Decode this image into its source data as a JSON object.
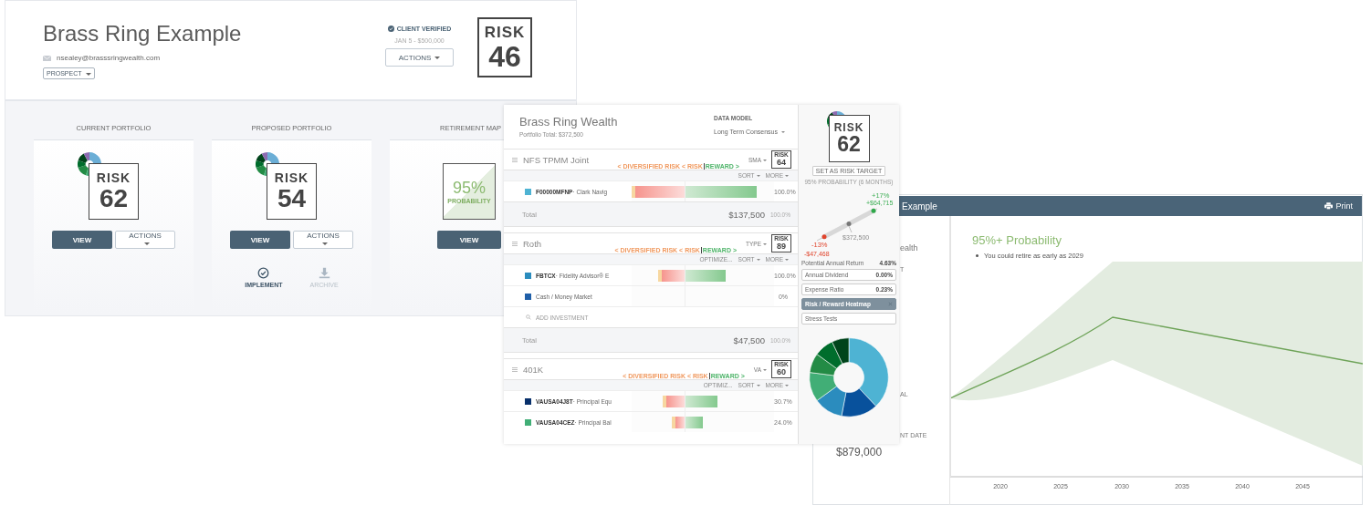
{
  "client_panel": {
    "name": "Brass Ring Example",
    "email": "nsealey@brasssringwealth.com",
    "status": "PROSPECT",
    "verification": "CLIENT VERIFIED",
    "verified_detail": "JAN 5 - $500,000",
    "actions": "ACTIONS",
    "risk": {
      "label": "RISK",
      "value": "46"
    },
    "cards": [
      {
        "kind": "portfolio",
        "title": "CURRENT PORTFOLIO",
        "risk": {
          "label": "RISK",
          "value": "62"
        },
        "view": "VIEW",
        "actions": "ACTIONS"
      },
      {
        "kind": "portfolio",
        "title": "PROPOSED PORTFOLIO",
        "risk": {
          "label": "RISK",
          "value": "54"
        },
        "view": "VIEW",
        "actions": "ACTIONS",
        "links": [
          {
            "kind": "implement",
            "label": "IMPLEMENT",
            "disabled": false
          },
          {
            "kind": "archive",
            "label": "ARCHIVE",
            "disabled": true
          }
        ]
      },
      {
        "kind": "probability",
        "title": "RETIREMENT MAP",
        "probability": {
          "value": "95%",
          "label": "PROBABILITY"
        },
        "view": "VIEW"
      }
    ]
  },
  "portfolio_panel": {
    "title": "Brass Ring Wealth",
    "total": "Portfolio Total: $372,500",
    "data_model_label": "DATA MODEL",
    "data_model": "Long Term Consensus",
    "accounts": [
      {
        "name": "NFS TPMM Joint",
        "legend_risk": "< DIVERSIFIED RISK < RISK",
        "legend_reward": "REWARD >",
        "type": "SMA",
        "risk": {
          "label": "RISK",
          "value": "64"
        },
        "tools": [
          {
            "label": "SORT",
            "dropdown": true
          },
          {
            "label": "MORE",
            "dropdown": true
          }
        ],
        "holdings": [
          {
            "ticker": "F00000MFNP",
            "name": "· Clark Navig",
            "color": "#4eb3d3",
            "bar": {
              "risk": {
                "level": 1
              },
              "reward": {
                "level": 0.8
              }
            },
            "percent": "100.0%"
          }
        ],
        "total": {
          "label": "Total",
          "value": "$137,500",
          "percent": "100.0%"
        }
      },
      {
        "name": "Roth",
        "legend_risk": "< DIVERSIFIED RISK < RISK",
        "legend_reward": "REWARD >",
        "type": "TYPE",
        "risk": {
          "label": "RISK",
          "value": "89"
        },
        "tools": [
          {
            "label": "OPTIMIZE...",
            "dropdown": false
          },
          {
            "label": "SORT",
            "dropdown": true
          },
          {
            "label": "MORE",
            "dropdown": true
          }
        ],
        "holdings": [
          {
            "ticker": "FBTCX",
            "name": "· Fidelity Advisor® E",
            "color": "#2b8cbe",
            "bar": {
              "risk": {
                "level": 0.5
              },
              "reward": {
                "level": 0.45
              }
            },
            "percent": "100.0%"
          },
          {
            "name": "Cash / Money Market",
            "color": "#1f5fa8",
            "percent": "0%"
          }
        ],
        "add": "ADD INVESTMENT",
        "total": {
          "label": "Total",
          "value": "$47,500",
          "percent": "100.0%"
        }
      },
      {
        "name": "401K",
        "legend_risk": "< DIVERSIFIED RISK < RISK",
        "legend_reward": "REWARD >",
        "type": "VA",
        "risk": {
          "label": "RISK",
          "value": "60"
        },
        "tools": [
          {
            "label": "OPTIMIZ...",
            "dropdown": false
          },
          {
            "label": "SORT",
            "dropdown": true
          },
          {
            "label": "MORE",
            "dropdown": true
          }
        ],
        "holdings": [
          {
            "ticker": "VAUSA04J8T",
            "name": "· Principal Equ",
            "color": "#08306b",
            "bar": {
              "risk": {
                "level": 0.41
              },
              "reward": {
                "level": 0.36
              }
            },
            "percent": "30.7%"
          },
          {
            "ticker": "VAUSA04CEZ",
            "name": "· Principal Bal",
            "color": "#41ae76",
            "bar": {
              "risk": {
                "level": 0.24
              },
              "reward": {
                "level": 0.2
              }
            },
            "percent": "24.0%"
          }
        ]
      }
    ],
    "sidebar": {
      "risk": {
        "label": "RISK",
        "value": "62"
      },
      "set_target": "SET AS RISK TARGET",
      "range": {
        "caption": "95% PROBABILITY (6 MONTHS)",
        "low_pct": "-13%",
        "low_value": "-$47,468",
        "current": "$372,500",
        "high_pct": "+17%",
        "high_value": "+$64,715"
      },
      "return_label": "Potential Annual Return",
      "return_value": "4.63%",
      "tools": [
        {
          "label": "Annual Dividend",
          "value": "0.00%",
          "selected": false
        },
        {
          "label": "Expense Ratio",
          "value": "0.23%",
          "selected": false
        },
        {
          "label": "Risk / Reward Heatmap",
          "selected": true
        },
        {
          "label": "Stress Tests",
          "selected": false
        }
      ]
    }
  },
  "retirement_panel": {
    "title": "Example",
    "print": "Print",
    "side_labels": [
      "ealth",
      "T",
      "AL",
      "NT DATE"
    ],
    "balance": "$879,000",
    "heading": "95%+ Probability",
    "bullets": [
      "You could retire as early as 2029"
    ],
    "x_labels": [
      "2020",
      "2025",
      "2030",
      "2035",
      "2040",
      "2045"
    ]
  }
}
